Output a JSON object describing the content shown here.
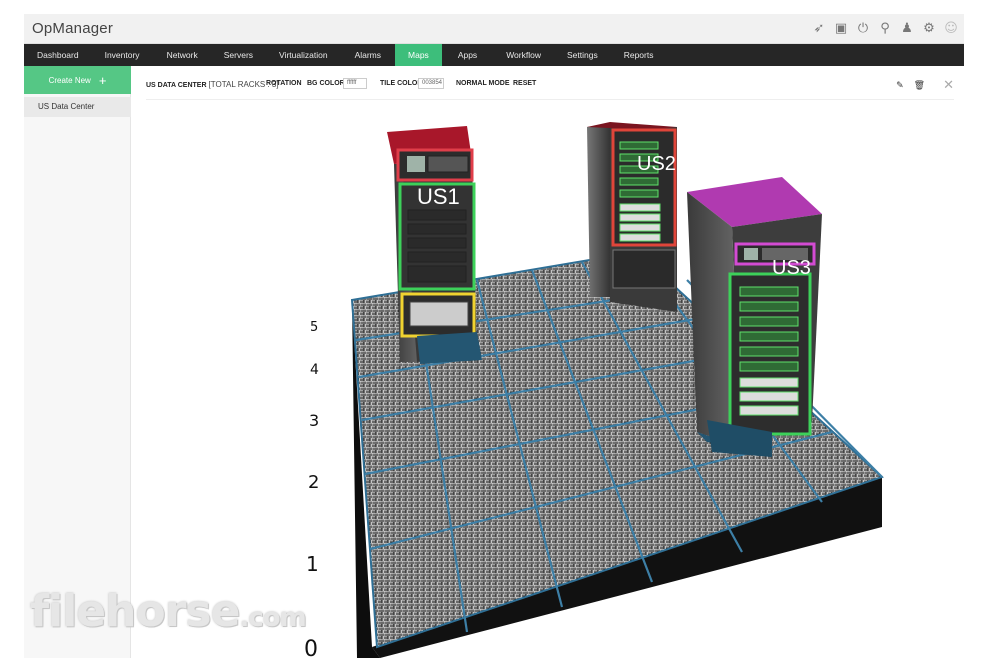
{
  "app": {
    "title": "OpManager"
  },
  "top_icons": [
    "rocket-icon",
    "monitor-icon",
    "plug-icon",
    "search-icon",
    "bell-icon",
    "gear-icon",
    "user-icon"
  ],
  "nav": {
    "items": [
      "Dashboard",
      "Inventory",
      "Network",
      "Servers",
      "Virtualization",
      "Alarms",
      "Maps",
      "Apps",
      "Workflow",
      "Settings",
      "Reports"
    ],
    "active": "Maps"
  },
  "sidebar": {
    "create_new": "Create New",
    "items": [
      "US Data Center"
    ]
  },
  "toolbar": {
    "title_bold": "US DATA CENTER",
    "title_rest": "[TOTAL RACKS : 3]",
    "rotation": "ROTATION",
    "bg_color_label": "BG COLOR",
    "bg_color_value": "ffffff",
    "tile_color_label": "TILE COLOR",
    "tile_color_value": "003854",
    "normal_mode": "NORMAL MODE",
    "reset": "RESET"
  },
  "floor": {
    "row_labels": [
      "5",
      "4",
      "3",
      "2",
      "1",
      "0"
    ],
    "racks": [
      {
        "label": "US1",
        "top_color": "#a8172a"
      },
      {
        "label": "US2",
        "top_color": "#7a1520"
      },
      {
        "label": "US3",
        "top_color": "#b03ab0"
      }
    ]
  },
  "watermark": {
    "brand": "filehorse",
    "suffix": ".com"
  }
}
